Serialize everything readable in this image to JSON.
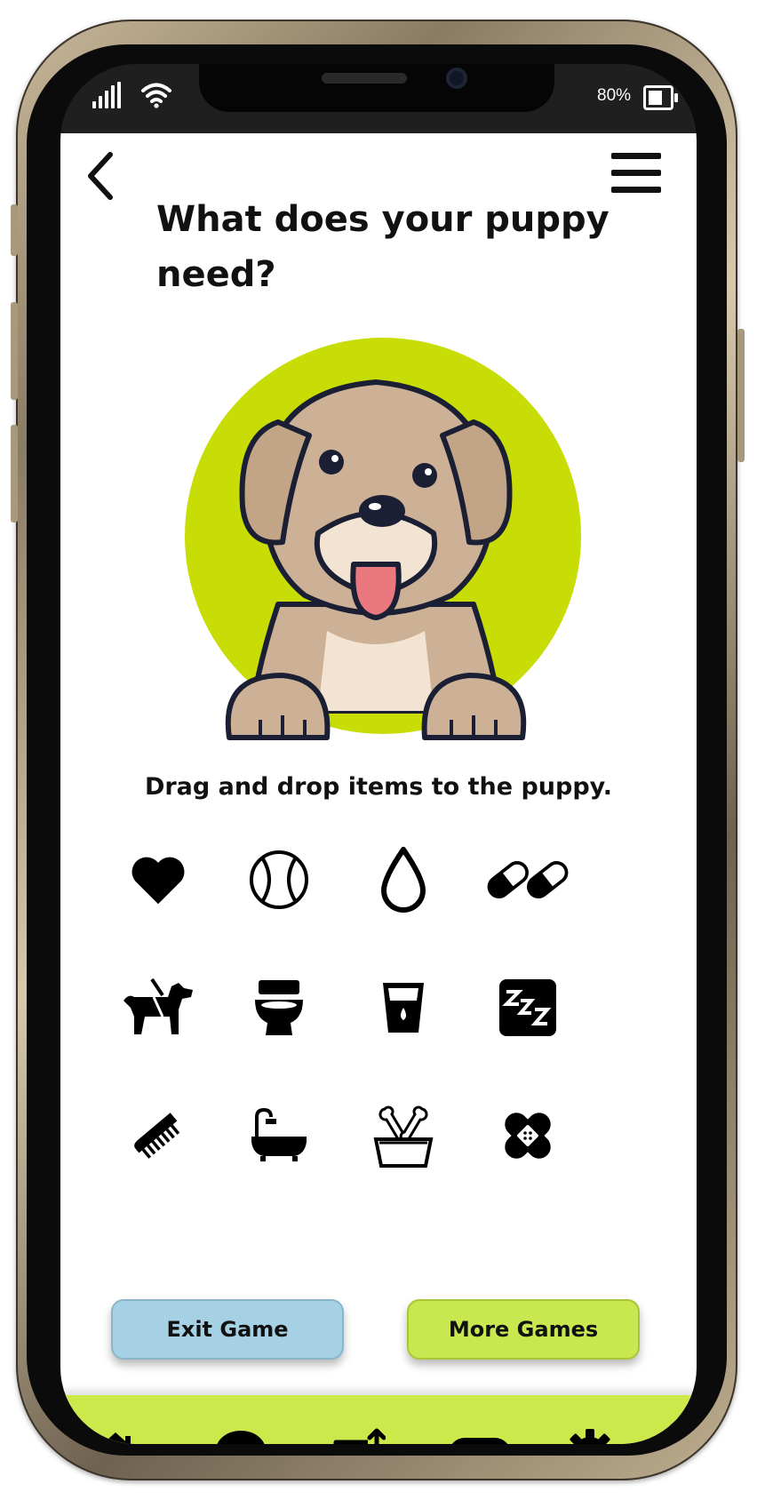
{
  "status_bar": {
    "battery": "80%"
  },
  "header": {
    "title": "What does your puppy need?"
  },
  "game": {
    "instruction": "Drag and drop items to the puppy.",
    "items": [
      "heart",
      "ball",
      "water-drop",
      "pills",
      "dog-walk",
      "toilet",
      "water-cup",
      "sleep",
      "comb",
      "bathtub",
      "food-bowl",
      "bandage"
    ]
  },
  "buttons": {
    "exit": "Exit Game",
    "more": "More Games"
  },
  "bottom_nav": [
    "home",
    "chat",
    "upload-image",
    "games",
    "settings"
  ],
  "colors": {
    "accent_green": "#c8dc05",
    "nav_green": "#cce94c",
    "exit_blue": "#a6d1e4"
  }
}
